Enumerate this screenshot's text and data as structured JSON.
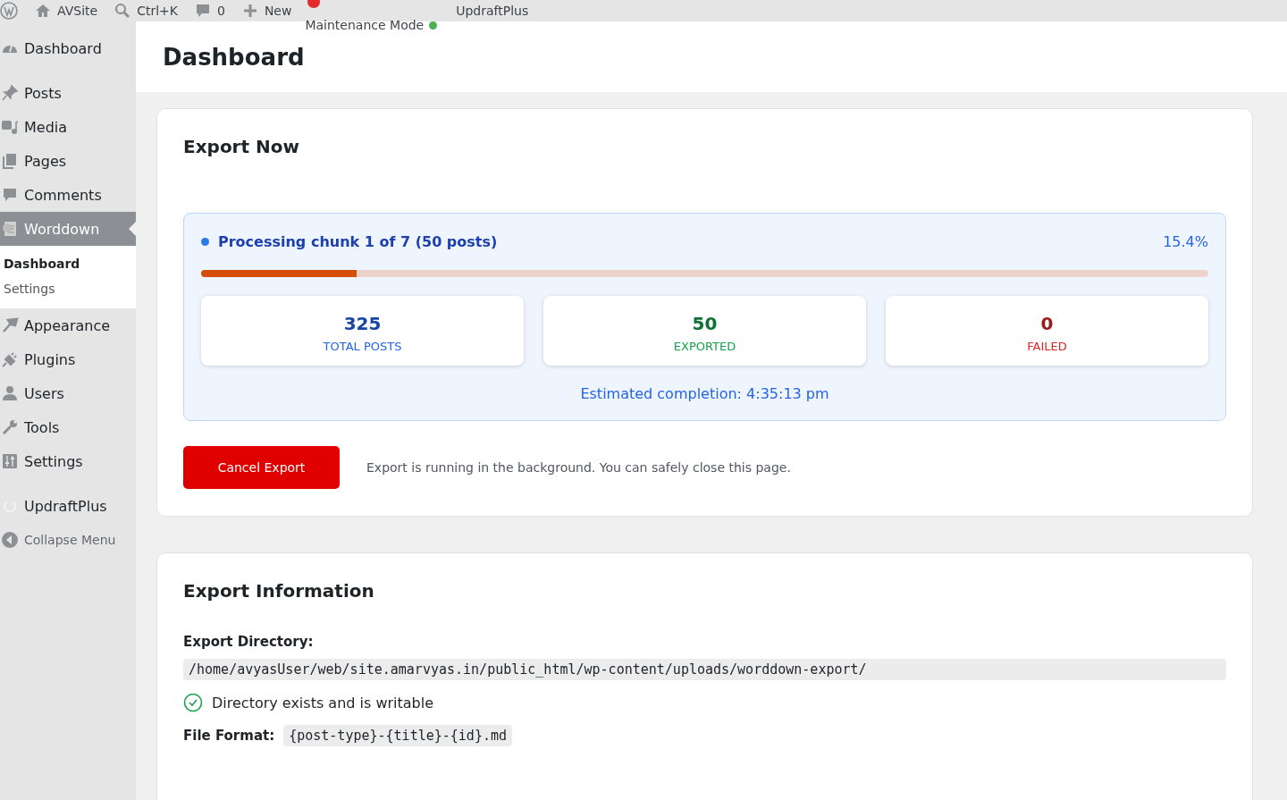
{
  "admin_bar": [
    {
      "kind": "wp"
    },
    {
      "kind": "home",
      "label": "AVSite"
    },
    {
      "kind": "search",
      "label": "Ctrl+K"
    },
    {
      "kind": "comment",
      "label": "0"
    },
    {
      "kind": "plus",
      "label": "New"
    },
    {
      "kind": "maintenance",
      "label": "Maintenance Mode"
    },
    {
      "kind": "plain",
      "label": "UpdraftPlus"
    }
  ],
  "sidebar": {
    "groups": [
      [
        {
          "kind": "dashboard",
          "label": "Dashboard",
          "selected": false
        }
      ],
      [
        {
          "kind": "pin",
          "label": "Posts",
          "selected": false
        },
        {
          "kind": "media",
          "label": "Media",
          "selected": false
        },
        {
          "kind": "pages",
          "label": "Pages",
          "selected": false
        },
        {
          "kind": "comment",
          "label": "Comments",
          "selected": false
        },
        {
          "kind": "doc",
          "label": "Worddown",
          "selected": true,
          "children": [
            {
              "label": "Dashboard",
              "selected": true
            },
            {
              "label": "Settings",
              "selected": false
            }
          ]
        },
        {
          "kind": "brush",
          "label": "Appearance",
          "selected": false
        },
        {
          "kind": "plug",
          "label": "Plugins",
          "selected": false
        },
        {
          "kind": "user",
          "label": "Users",
          "selected": false
        },
        {
          "kind": "wrench",
          "label": "Tools",
          "selected": false
        },
        {
          "kind": "sliders",
          "label": "Settings",
          "selected": false
        }
      ],
      [
        {
          "kind": "updraft",
          "label": "UpdraftPlus",
          "selected": false
        },
        {
          "kind": "collapse",
          "label": "Collapse Menu",
          "selected": false
        }
      ]
    ]
  },
  "page_title": "Dashboard",
  "export_card": {
    "title": "Export Now",
    "progress": {
      "status": "Processing chunk 1 of 7 (50 posts)",
      "percent": "15.4%",
      "level": 0.154,
      "stats": [
        {
          "value": "325",
          "label": "TOTAL POSTS",
          "color": "#2563eb"
        },
        {
          "value": "50",
          "label": "EXPORTED",
          "color": "#16a34a"
        },
        {
          "value": "0",
          "label": "FAILED",
          "color": "#dc2626"
        }
      ],
      "estimate": "Estimated completion: 4:35:13 pm"
    },
    "cancel_button": "Cancel Export",
    "note": "Export is running in the background. You can safely close this page."
  },
  "info_card": {
    "title": "Export Information",
    "directory_label": "Export Directory:",
    "directory": "/home/avyasUser/web/site.amarvyas.in/public_html/wp-content/uploads/worddown-export/",
    "directory_status": "Directory exists and is writable",
    "format_label": "File Format:",
    "format": "{post-type}-{title}-{id}.md"
  }
}
